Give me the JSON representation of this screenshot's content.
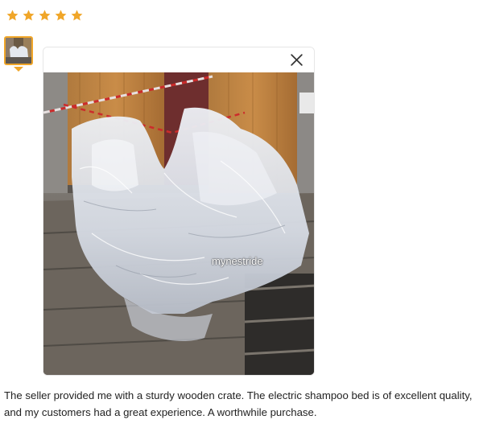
{
  "rating": {
    "stars": 5,
    "max": 5,
    "color": "#f0a629"
  },
  "thumbnail": {
    "selected": true,
    "border_color": "#f0a629"
  },
  "viewer": {
    "close_icon": "close-icon",
    "watermark": "mynestride"
  },
  "review": {
    "text": "The seller provided me with a sturdy wooden crate. The electric shampoo bed is of excellent quality, and my customers had a great experience. A worthwhile purchase."
  }
}
